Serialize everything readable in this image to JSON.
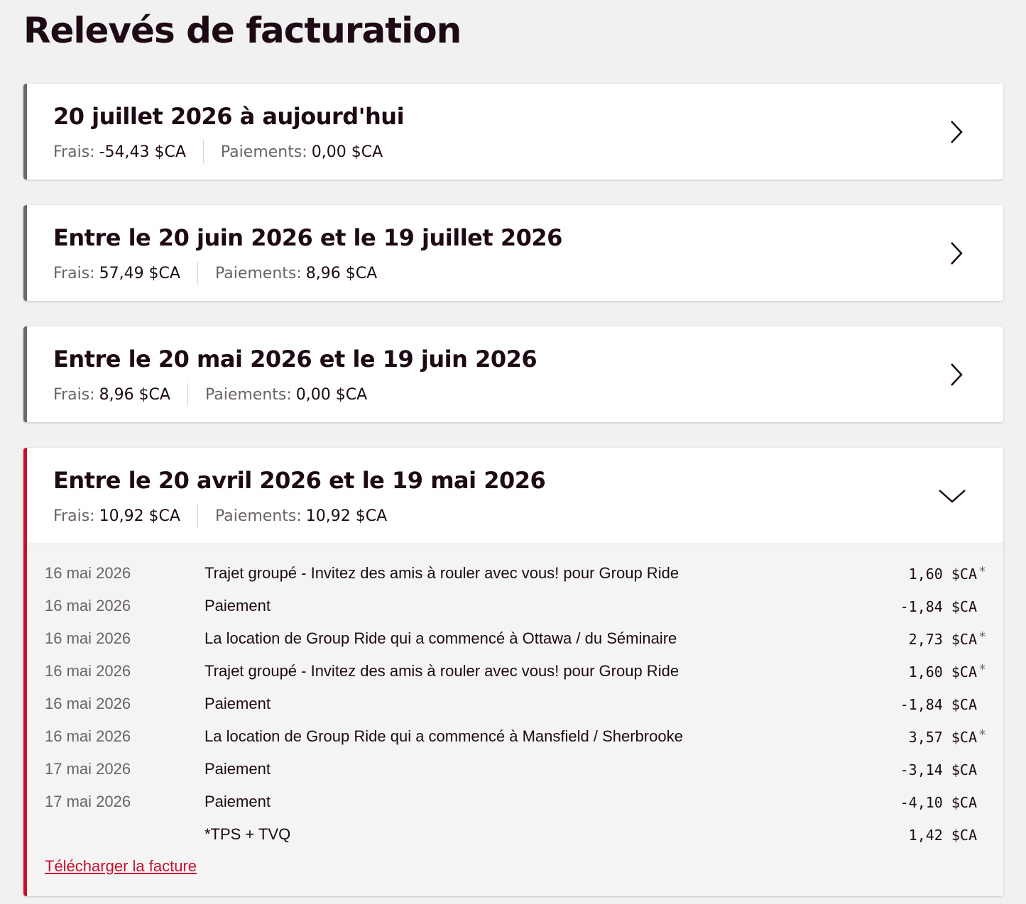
{
  "page": {
    "title": "Relevés de facturation"
  },
  "colors": {
    "accent": "#c8102e",
    "collapsed_border": "#6f6669",
    "text": "#1d0a14",
    "muted": "#6b6367"
  },
  "statements": [
    {
      "title": "20 juillet 2026 à aujourd'hui",
      "fees_label": "Frais:",
      "fees_value": "-54,43 $CA",
      "payments_label": "Paiements:",
      "payments_value": "0,00 $CA",
      "icon": "chevron-right-icon"
    },
    {
      "title": "Entre le 20 juin 2026 et le 19 juillet 2026",
      "fees_label": "Frais:",
      "fees_value": "57,49 $CA",
      "payments_label": "Paiements:",
      "payments_value": "8,96 $CA",
      "icon": "chevron-right-icon"
    },
    {
      "title": "Entre le 20 mai 2026 et le 19 juin 2026",
      "fees_label": "Frais:",
      "fees_value": "8,96 $CA",
      "payments_label": "Paiements:",
      "payments_value": "0,00 $CA",
      "icon": "chevron-right-icon"
    },
    {
      "title": "Entre le 20 avril 2026 et le 19 mai 2026",
      "fees_label": "Frais:",
      "fees_value": "10,92 $CA",
      "payments_label": "Paiements:",
      "payments_value": "10,92 $CA",
      "icon": "chevron-down-icon",
      "transactions": [
        {
          "date": "16 mai 2026",
          "description": "Trajet groupé - Invitez des amis à rouler avec vous! pour Group Ride",
          "amount": "1,60 $CA",
          "tax_mark": "*"
        },
        {
          "date": "16 mai 2026",
          "description": "Paiement",
          "amount": "-1,84 $CA",
          "tax_mark": ""
        },
        {
          "date": "16 mai 2026",
          "description": "La location de Group Ride qui a commencé à Ottawa / du Séminaire",
          "amount": "2,73 $CA",
          "tax_mark": "*"
        },
        {
          "date": "16 mai 2026",
          "description": "Trajet groupé - Invitez des amis à rouler avec vous! pour Group Ride",
          "amount": "1,60 $CA",
          "tax_mark": "*"
        },
        {
          "date": "16 mai 2026",
          "description": "Paiement",
          "amount": "-1,84 $CA",
          "tax_mark": ""
        },
        {
          "date": "16 mai 2026",
          "description": "La location de Group Ride qui a commencé à Mansfield / Sherbrooke",
          "amount": "3,57 $CA",
          "tax_mark": "*"
        },
        {
          "date": "17 mai 2026",
          "description": "Paiement",
          "amount": "-3,14 $CA",
          "tax_mark": ""
        },
        {
          "date": "17 mai 2026",
          "description": "Paiement",
          "amount": "-4,10 $CA",
          "tax_mark": ""
        },
        {
          "date": "",
          "description": "*TPS + TVQ",
          "amount": "1,42 $CA",
          "tax_mark": ""
        }
      ],
      "download_label": "Télécharger la facture"
    }
  ]
}
